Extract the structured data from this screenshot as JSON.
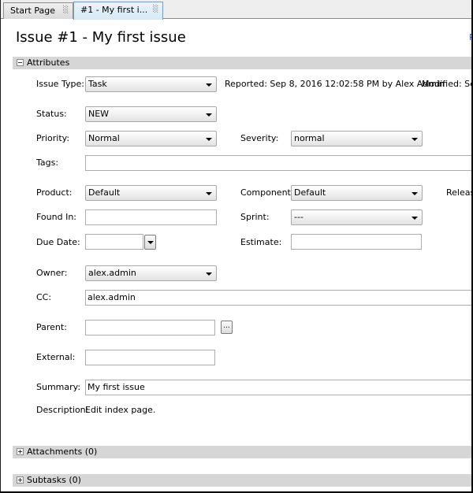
{
  "tabs": [
    {
      "label": "Start Page",
      "active": false,
      "close_icon": "close-tab-icon"
    },
    {
      "label": "#1 - My first i...",
      "active": true,
      "close_icon": "close-tab-icon"
    }
  ],
  "header": {
    "title": "Issue #1 - My first issue",
    "refresh_link": "R"
  },
  "sections": {
    "attributes": {
      "label": "Attributes",
      "expanded": true
    },
    "attachments": {
      "label": "Attachments (0)",
      "expanded": false
    },
    "subtasks": {
      "label": "Subtasks (0)",
      "expanded": false
    }
  },
  "fields": {
    "issue_type": {
      "label": "Issue Type:",
      "value": "Task"
    },
    "reported_info": "Reported: Sep 8, 2016 12:02:58 PM by Alex Admin",
    "modified_info": "Modified: Sep",
    "status": {
      "label": "Status:",
      "value": "NEW"
    },
    "priority": {
      "label": "Priority:",
      "value": "Normal"
    },
    "severity": {
      "label": "Severity:",
      "value": "normal"
    },
    "tags": {
      "label": "Tags:",
      "value": ""
    },
    "product": {
      "label": "Product:",
      "value": "Default"
    },
    "component": {
      "label": "Component:",
      "value": "Default"
    },
    "release_label": "Releas",
    "found_in": {
      "label": "Found In:",
      "value": ""
    },
    "sprint": {
      "label": "Sprint:",
      "value": "---"
    },
    "due_date": {
      "label": "Due Date:",
      "value": ""
    },
    "estimate": {
      "label": "Estimate:",
      "value": ""
    },
    "owner": {
      "label": "Owner:",
      "value": "alex.admin"
    },
    "cc": {
      "label": "CC:",
      "value": "alex.admin"
    },
    "parent": {
      "label": "Parent:",
      "value": "",
      "browse_label": "..."
    },
    "external": {
      "label": "External:",
      "value": ""
    },
    "summary": {
      "label": "Summary:",
      "value": "My first issue"
    },
    "description": {
      "label": "Description:",
      "value": "Edit index page."
    }
  }
}
